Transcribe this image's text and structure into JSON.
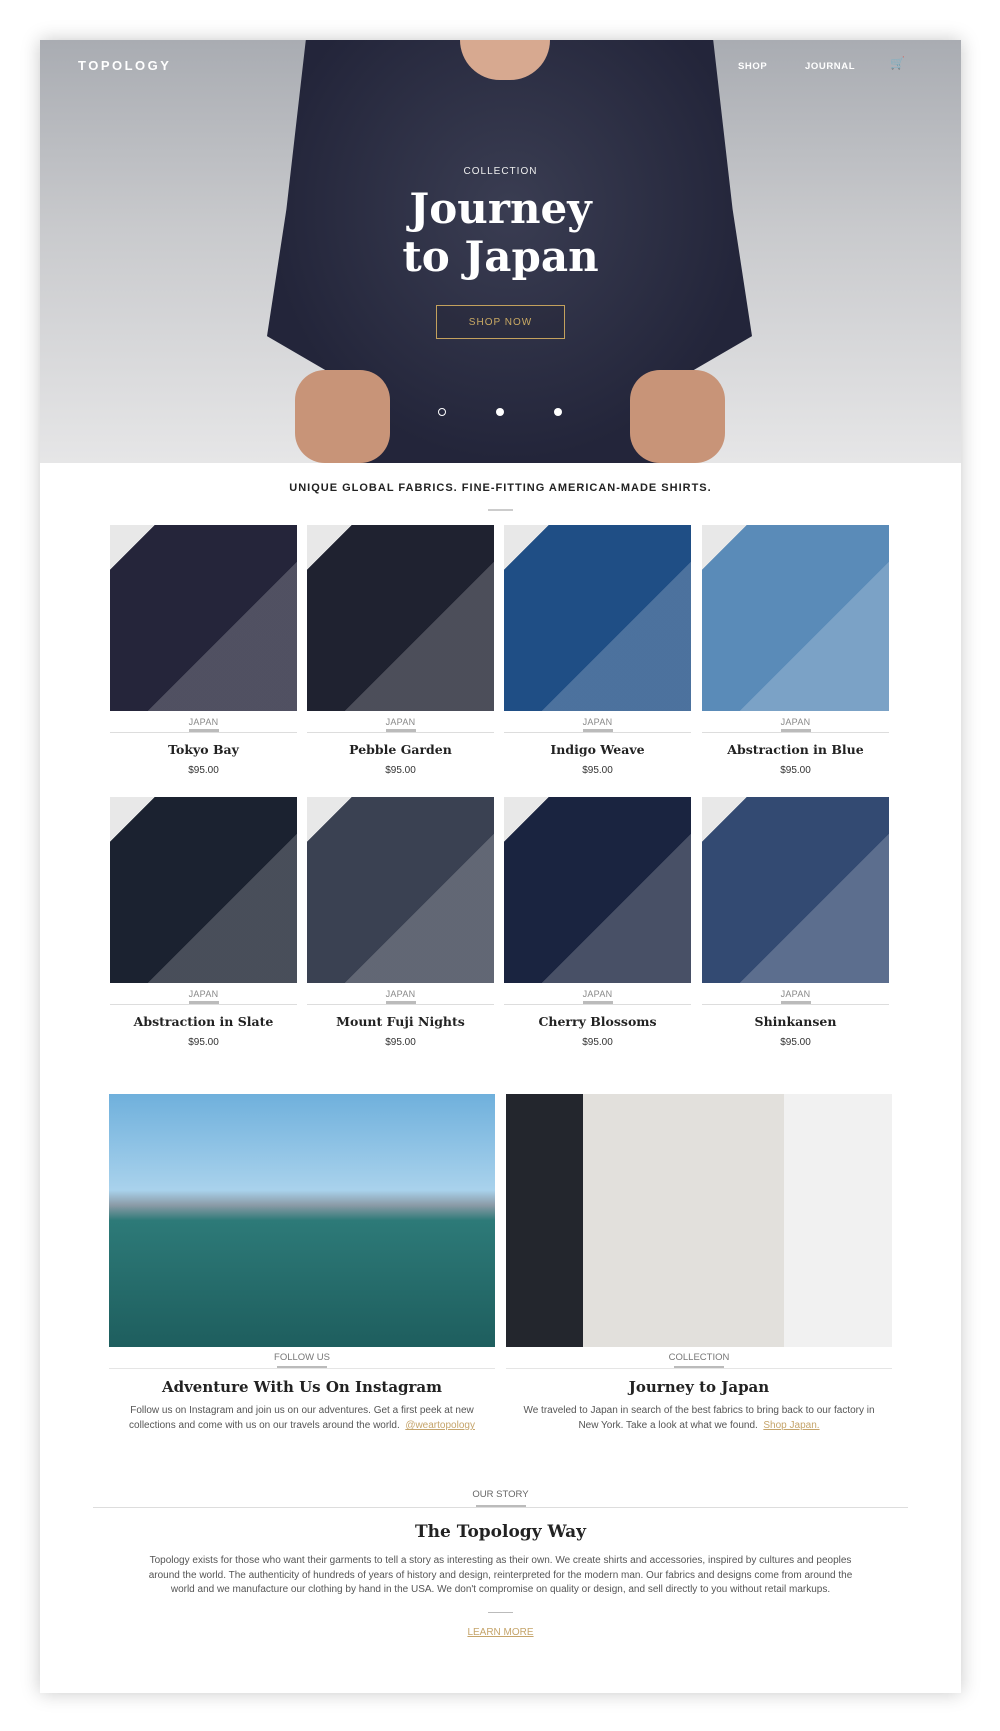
{
  "header": {
    "logo": "TOPOLOGY",
    "nav": [
      "SHOP",
      "JOURNAL"
    ],
    "cart_icon": "cart-icon"
  },
  "hero": {
    "kicker": "COLLECTION",
    "title": "Journey to Japan",
    "button": "SHOP NOW",
    "slides": 3,
    "active_slide": 1,
    "accent": "#c3a15d"
  },
  "tagline": "UNIQUE GLOBAL FABRICS. FINE-FITTING AMERICAN-MADE SHIRTS.",
  "products": [
    {
      "category": "JAPAN",
      "name": "Tokyo Bay",
      "price": "$95.00",
      "color": "#25253a"
    },
    {
      "category": "JAPAN",
      "name": "Pebble Garden",
      "price": "$95.00",
      "color": "#1f2230"
    },
    {
      "category": "JAPAN",
      "name": "Indigo Weave",
      "price": "$95.00",
      "color": "#1f4e85"
    },
    {
      "category": "JAPAN",
      "name": "Abstraction in Blue",
      "price": "$95.00",
      "color": "#5a8bb8"
    },
    {
      "category": "JAPAN",
      "name": "Abstraction in Slate",
      "price": "$95.00",
      "color": "#1b2230"
    },
    {
      "category": "JAPAN",
      "name": "Mount Fuji Nights",
      "price": "$95.00",
      "color": "#3a4152"
    },
    {
      "category": "JAPAN",
      "name": "Cherry Blossoms",
      "price": "$95.00",
      "color": "#1a2440"
    },
    {
      "category": "JAPAN",
      "name": "Shinkansen",
      "price": "$95.00",
      "color": "#334a72"
    }
  ],
  "features": [
    {
      "category": "FOLLOW US",
      "title": "Adventure With Us On Instagram",
      "text": "Follow us on Instagram and join us on our adventures.  Get a first peek at new collections and come with us on our travels around the world.",
      "link": "@weartopology"
    },
    {
      "category": "COLLECTION",
      "title": "Journey to Japan",
      "text": "We traveled to Japan in search of the best fabrics to bring back to our factory in New York. Take a look at what we found.",
      "link": "Shop Japan."
    }
  ],
  "story": {
    "category": "OUR STORY",
    "title": "The Topology Way",
    "text": "Topology exists for those who want their garments to tell a story as interesting as their own. We create shirts and accessories, inspired by cultures and peoples around the world. The authenticity of hundreds of years of history and design, reinterpreted for the modern man. Our fabrics and designs come from around the world and we manufacture our clothing by hand in the USA.  We don't compromise on quality or design, and sell directly to you without retail markups.",
    "link": "LEARN MORE"
  }
}
